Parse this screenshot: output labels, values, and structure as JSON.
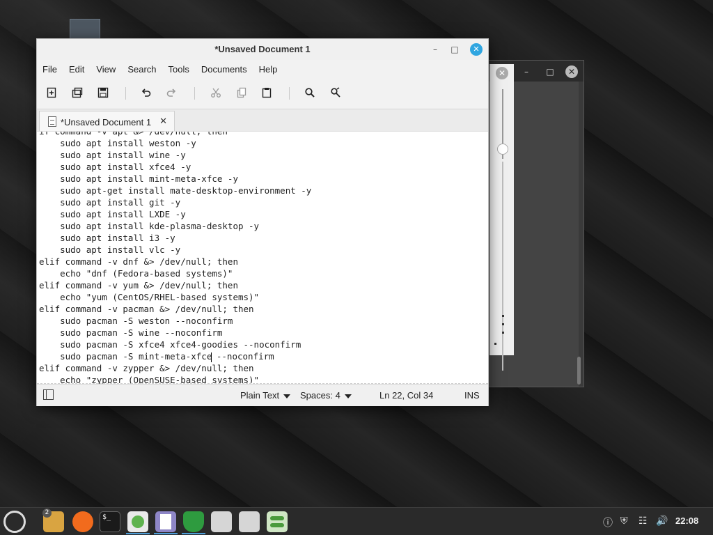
{
  "window": {
    "title": "*Unsaved Document 1",
    "minimize": "–",
    "maximize": "□",
    "close": "✕"
  },
  "background_window": {
    "close": "✕",
    "minimize": "–",
    "maximize": "□"
  },
  "menu": [
    "File",
    "Edit",
    "Search",
    "Tools",
    "Documents",
    "Help"
  ],
  "view_menu": "View",
  "toolbar": {
    "icons": [
      "new-document-icon",
      "new-window-icon",
      "save-icon",
      "undo-icon",
      "redo-icon",
      "cut-icon",
      "copy-icon",
      "paste-icon",
      "find-icon",
      "replace-icon"
    ]
  },
  "tab": {
    "label": "*Unsaved Document 1",
    "close": "✕"
  },
  "editor": {
    "lines": [
      "if command -v apt &> /dev/null; then",
      "    sudo apt install weston -y",
      "    sudo apt install wine -y",
      "    sudo apt install xfce4 -y",
      "    sudo apt install mint-meta-xfce -y",
      "    sudo apt-get install mate-desktop-environment -y",
      "    sudo apt install git -y",
      "    sudo apt install LXDE -y",
      "    sudo apt install kde-plasma-desktop -y",
      "    sudo apt install i3 -y",
      "    sudo apt install vlc -y",
      "elif command -v dnf &> /dev/null; then",
      "    echo \"dnf (Fedora-based systems)\"",
      "elif command -v yum &> /dev/null; then",
      "    echo \"yum (CentOS/RHEL-based systems)\"",
      "elif command -v pacman &> /dev/null; then",
      "    sudo pacman -S weston --noconfirm",
      "    sudo pacman -S wine --noconfirm",
      "    sudo pacman -S xfce4 xfce4-goodies --noconfirm",
      "    sudo pacman -S mint-meta-xfce --noconfirm",
      "elif command -v zypper &> /dev/null; then",
      "    echo \"zypper (OpenSUSE-based systems)\""
    ],
    "cursor_line_index": 19,
    "cursor_after_text": "    sudo pacman -S mint-meta-xfce"
  },
  "status": {
    "language": "Plain Text",
    "spaces": "Spaces: 4",
    "position": "Ln 22, Col 34",
    "mode": "INS"
  },
  "taskbar": {
    "badge": "2",
    "terminal_glyph": "$_",
    "clock": "22:08",
    "colors": {
      "accent": "#4d9ed8",
      "window_close": "#2fa5e0"
    }
  }
}
